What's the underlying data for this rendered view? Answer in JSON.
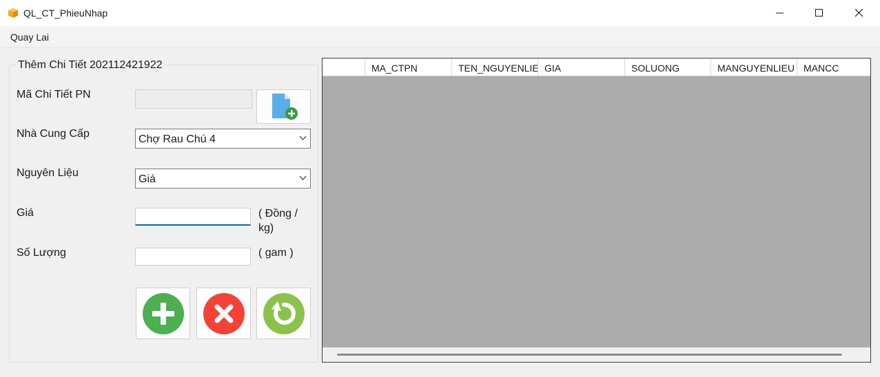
{
  "window": {
    "title": "QL_CT_PhieuNhap",
    "minimize_icon": "minimize-icon",
    "maximize_icon": "maximize-icon",
    "close_icon": "close-icon"
  },
  "menu": {
    "back_label": "Quay Lai"
  },
  "form": {
    "group_title": "Thêm Chi Tiết 202112421922",
    "ma_label": "Mã Chi Tiết PN",
    "ma_value": "",
    "ncc_label": "Nhà Cung Cấp",
    "ncc_value": "Chợ Rau Chú 4",
    "nguyenlieu_label": "Nguyên Liệu",
    "nguyenlieu_value": "Giá",
    "gia_label": "Giá",
    "gia_value": "",
    "gia_unit_line1": "( Đồng /",
    "gia_unit_line2": "kg)",
    "soluong_label": "Số Lượng",
    "soluong_value": "",
    "soluong_unit": "( gam )",
    "icons": {
      "new": "new-document-icon",
      "add": "add-icon",
      "delete": "delete-icon",
      "refresh": "refresh-icon"
    }
  },
  "grid": {
    "columns": [
      "MA_CTPN",
      "TEN_NGUYENLIE",
      "GIA",
      "SOLUONG",
      "MANGUYENLIEU",
      "MANCC"
    ],
    "rows": []
  },
  "colors": {
    "add_green": "#4caf50",
    "delete_red": "#f44336",
    "refresh_green": "#8bc34a",
    "focus_blue": "#0067c0",
    "grid_bg": "#ababab"
  }
}
